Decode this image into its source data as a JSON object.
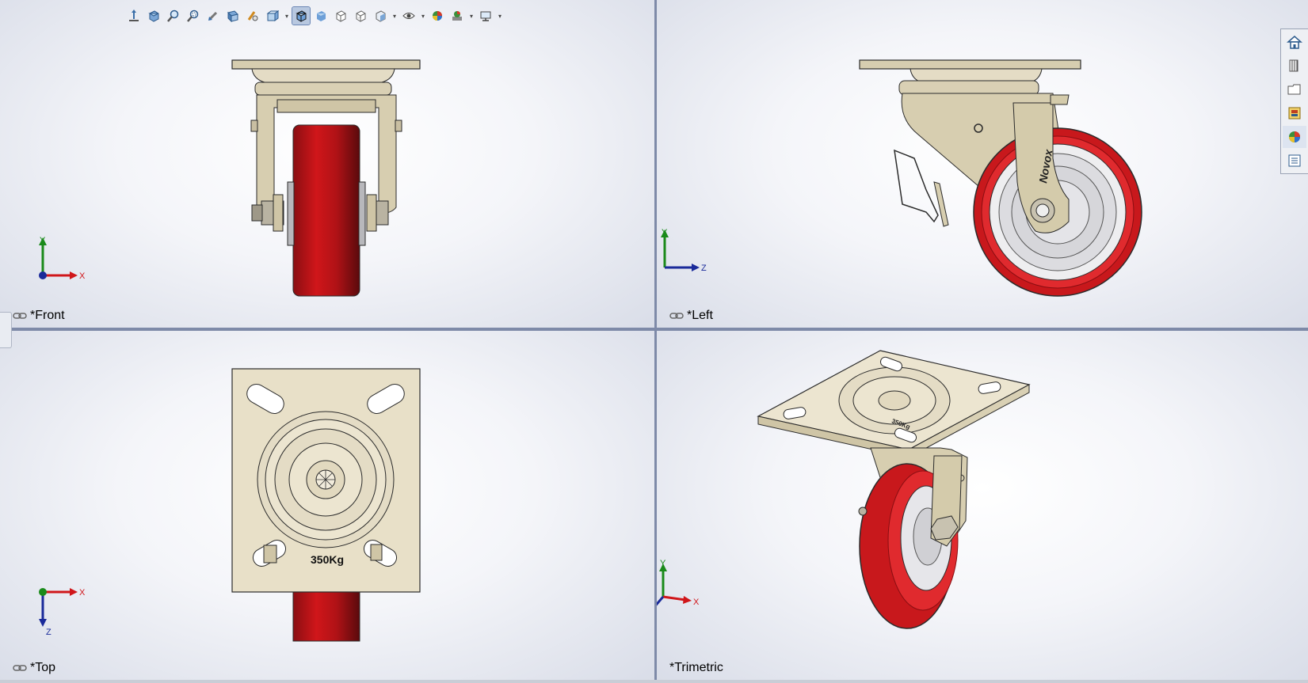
{
  "toolbar": {
    "items": [
      {
        "name": "view-orientation-icon",
        "caret": false
      },
      {
        "name": "standard-views-icon",
        "caret": false
      },
      {
        "name": "zoom-to-fit-icon",
        "caret": false
      },
      {
        "name": "zoom-to-area-icon",
        "caret": false
      },
      {
        "name": "previous-view-icon",
        "caret": false
      },
      {
        "name": "section-view-icon",
        "caret": false
      },
      {
        "name": "dynamic-annotation-icon",
        "caret": false
      },
      {
        "name": "view-orientation-dropdown-icon",
        "caret": true
      },
      {
        "name": "shaded-with-edges-icon",
        "caret": false,
        "active": true
      },
      {
        "name": "shaded-icon",
        "caret": false
      },
      {
        "name": "hidden-lines-removed-icon",
        "caret": false
      },
      {
        "name": "hidden-lines-visible-icon",
        "caret": false
      },
      {
        "name": "display-style-icon",
        "caret": true
      },
      {
        "name": "hide-show-items-icon",
        "caret": true
      },
      {
        "name": "edit-appearance-icon",
        "caret": false
      },
      {
        "name": "apply-scene-icon",
        "caret": true
      },
      {
        "name": "view-settings-icon",
        "caret": true
      }
    ]
  },
  "viewports": {
    "front": {
      "label": "*Front",
      "axis1": "X",
      "axis2": "Y"
    },
    "left": {
      "label": "*Left",
      "axis1": "Z",
      "axis2": "Y"
    },
    "top": {
      "label": "*Top",
      "axis1": "X",
      "axis2": "Z"
    },
    "trimetric": {
      "label": "*Trimetric",
      "axis1": "X",
      "axis2": "Y",
      "axis3": "Z"
    }
  },
  "model": {
    "brand_text": "Novox",
    "load_text": "350Kg",
    "colors": {
      "wheel_red": "#d0161a",
      "wheel_dark": "#7a0c10",
      "body_beige": "#d9d0b4",
      "plate_beige": "#e8e0c8",
      "edge": "#2b2b2b"
    }
  },
  "taskpane": {
    "items": [
      "home-icon",
      "design-library-icon",
      "file-explorer-icon",
      "view-palette-icon",
      "appearances-icon",
      "custom-properties-icon"
    ]
  }
}
